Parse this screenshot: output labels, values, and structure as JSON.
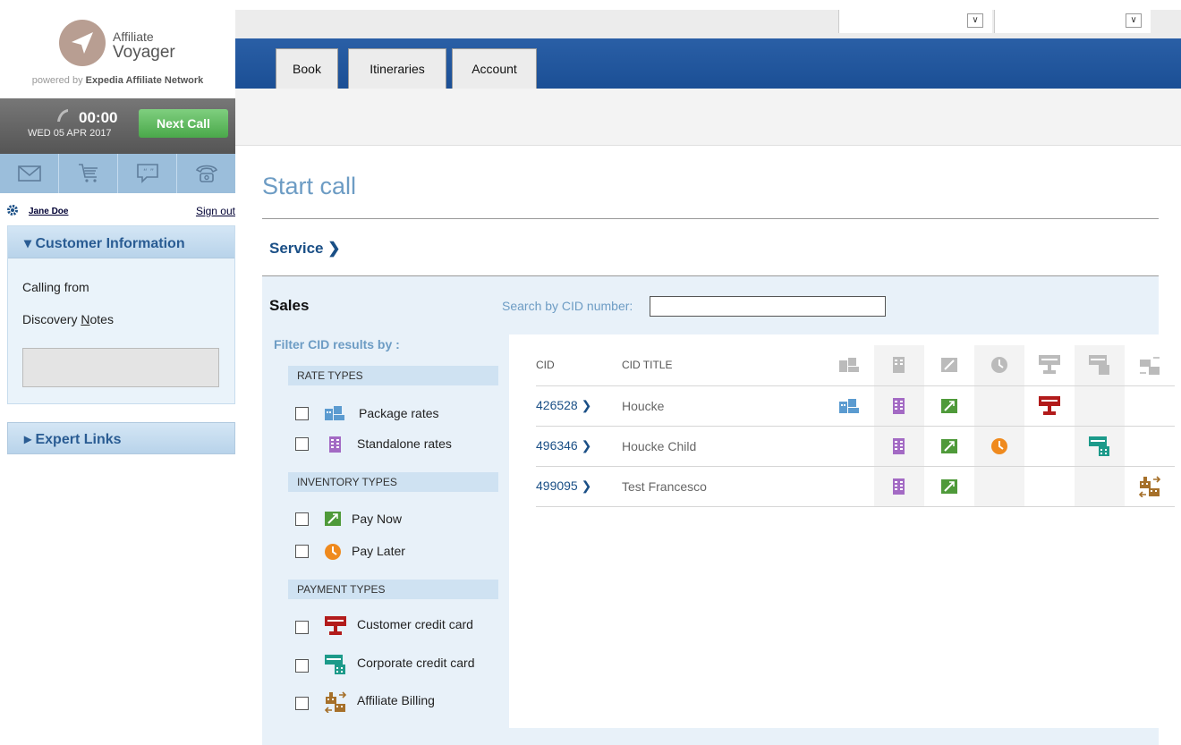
{
  "logo": {
    "line1": "Affiliate",
    "line2": "Voyager",
    "powered_prefix": "powered by",
    "powered_brand": "Expedia Affiliate Network"
  },
  "callbar": {
    "timer": "00:00",
    "date": "WED 05 APR 2017",
    "next_call_label": "Next Call"
  },
  "iconbar": [
    "mail-icon",
    "cart-icon",
    "chat-icon",
    "telephone-icon"
  ],
  "user": {
    "name": "Jane Doe",
    "sign_out": "Sign out"
  },
  "customer_panel": {
    "title": "▾ Customer Information",
    "calling_from": "Calling from",
    "discovery_notes_pre": "Discovery ",
    "discovery_notes_underlined": "N",
    "discovery_notes_post": "otes"
  },
  "expert_links": {
    "title": "▸ Expert Links"
  },
  "nav": {
    "tabs": [
      "Book",
      "Itineraries",
      "Account"
    ]
  },
  "main": {
    "title": "Start call",
    "service_label": "Service",
    "sales_label": "Sales",
    "search_label": "Search by CID number:",
    "search_value": "",
    "filter_label": "Filter CID results by :"
  },
  "filters": {
    "rate_types_head": "RATE TYPES",
    "package_rates": "Package rates",
    "standalone_rates": "Standalone rates",
    "inventory_types_head": "INVENTORY TYPES",
    "pay_now": "Pay Now",
    "pay_later": "Pay Later",
    "payment_types_head": "PAYMENT TYPES",
    "customer_card": "Customer credit card",
    "corporate_card": "Corporate credit card",
    "affiliate_billing": "Affiliate Billing"
  },
  "table": {
    "headers": {
      "cid": "CID",
      "title": "CID TITLE"
    },
    "rows": [
      {
        "cid": "426528",
        "title": "Houcke"
      },
      {
        "cid": "496346",
        "title": "Houcke Child"
      },
      {
        "cid": "499095",
        "title": "Test Francesco"
      }
    ]
  },
  "colors": {
    "package": "#5b9bd0",
    "standalone": "#a36ac4",
    "pay_now": "#4f9a3a",
    "pay_later": "#ef8a1e",
    "customer_card": "#b21b1b",
    "corporate_card": "#1c9a8a",
    "affiliate": "#a6702a"
  }
}
